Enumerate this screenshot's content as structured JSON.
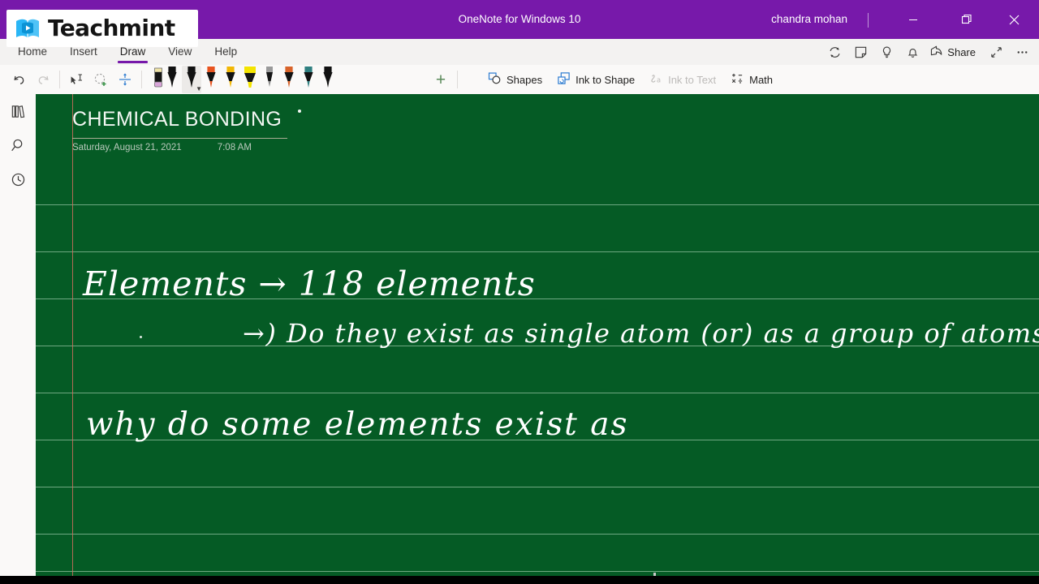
{
  "titlebar": {
    "app_title": "OneNote for Windows 10",
    "user_name": "chandra mohan",
    "minimize_label": "Minimize",
    "maximize_label": "Restore",
    "close_label": "Close",
    "accent_color": "#7719aa"
  },
  "brand": {
    "name": "Teachmint",
    "logo_icon": "book-play-icon",
    "logo_color": "#29b6f6"
  },
  "ribbon": {
    "tabs": [
      {
        "label": "Home",
        "active": false
      },
      {
        "label": "Insert",
        "active": false
      },
      {
        "label": "Draw",
        "active": true
      },
      {
        "label": "View",
        "active": false
      },
      {
        "label": "Help",
        "active": false
      }
    ],
    "right_icons": [
      {
        "name": "sync-icon",
        "label": "Sync"
      },
      {
        "name": "sticky-note-icon",
        "label": "Sticky Notes"
      },
      {
        "name": "lightbulb-icon",
        "label": "Tell me what you want to do"
      },
      {
        "name": "bell-icon",
        "label": "Notifications"
      }
    ],
    "share_label": "Share",
    "share_icon": "share-icon",
    "fullscreen_icon": "fullscreen-icon",
    "more_icon": "ellipsis-icon"
  },
  "drawbar": {
    "undo_label": "Undo",
    "redo_label": "Redo",
    "lasso_text_label": "Lasso Select",
    "lasso_add_label": "Add Selection",
    "insert_space_label": "Insert Space",
    "eraser_label": "Eraser",
    "pens": [
      {
        "name": "pen-black",
        "body": "#111111",
        "tip": "#111111",
        "type": "pen",
        "selected": false
      },
      {
        "name": "pen-black-selected",
        "body": "#111111",
        "tip": "#111111",
        "type": "pen",
        "selected": true
      },
      {
        "name": "pen-orange",
        "body": "#111111",
        "tip": "#e8541f",
        "type": "pen",
        "selected": false
      },
      {
        "name": "pen-yellow",
        "body": "#111111",
        "tip": "#f2b705",
        "type": "pen",
        "selected": false
      },
      {
        "name": "highlighter-yellow",
        "body": "#f4e400",
        "tip": "#f4e400",
        "type": "highlighter",
        "selected": false
      },
      {
        "name": "pencil-gray",
        "body": "#111111",
        "tip": "#8a8a8a",
        "type": "pencil",
        "selected": false
      },
      {
        "name": "pen-rainbow",
        "body": "#111111",
        "tip": "#d8632a",
        "type": "pen",
        "selected": false
      },
      {
        "name": "pen-galaxy",
        "body": "#111111",
        "tip": "#2f7f80",
        "type": "pen",
        "selected": false
      },
      {
        "name": "pen-black-2",
        "body": "#111111",
        "tip": "#111111",
        "type": "pen",
        "selected": false
      }
    ],
    "add_pen_label": "Add Pen",
    "shapes_label": "Shapes",
    "shapes_icon": "shapes-icon",
    "ink_to_shape_label": "Ink to Shape",
    "ink_to_shape_icon": "ink-to-shape-icon",
    "ink_to_text_label": "Ink to Text",
    "ink_to_text_icon": "ink-to-text-icon",
    "ink_to_text_disabled": true,
    "math_label": "Math",
    "math_icon": "math-icon"
  },
  "rail": {
    "items": [
      {
        "name": "notebooks-icon",
        "label": "Notebooks"
      },
      {
        "name": "search-icon",
        "label": "Search"
      },
      {
        "name": "recent-icon",
        "label": "Recent Notes"
      }
    ]
  },
  "page": {
    "title": "CHEMICAL BONDING",
    "date": "Saturday, August 21, 2021",
    "time": "7:08 AM",
    "background_color": "#055b25",
    "rule_color": "#c4e8ce",
    "margin_color": "#d26e5f",
    "ink_color": "#ffffff",
    "ink_lines": [
      "Elements → 118 elements",
      "→) Do they exist as single atom (or) as a group of atoms?",
      "why do some elements exist as"
    ]
  }
}
